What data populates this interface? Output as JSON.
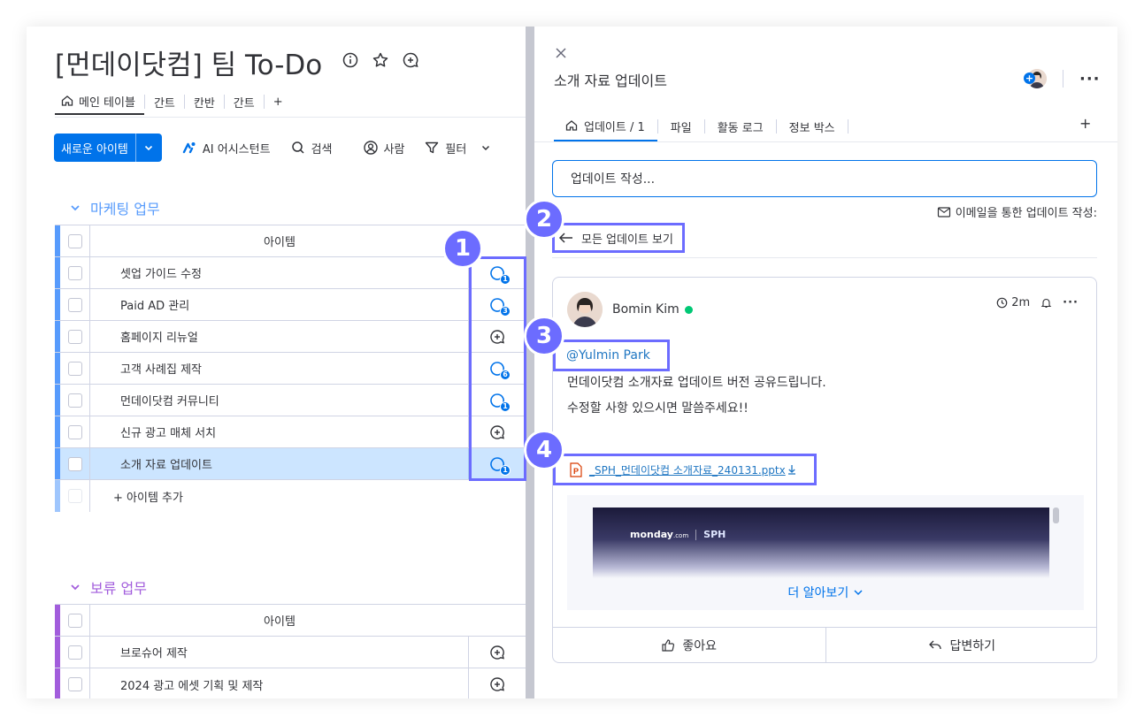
{
  "board": {
    "title": "[먼데이닷컴] 팀 To-Do",
    "views": [
      "메인 테이블",
      "간트",
      "칸반",
      "간트",
      "+"
    ],
    "toolbar": {
      "new_item": "새로운 아이템",
      "ai": "AI 어시스턴트",
      "search": "검색",
      "person": "사람",
      "filter": "필터"
    }
  },
  "groups": [
    {
      "title": "마케팅 업무",
      "color": "#579bfc",
      "header": "아이템",
      "items": [
        {
          "name": "셋업 가이드 수정",
          "badge": "1"
        },
        {
          "name": "Paid AD 관리",
          "badge": "3"
        },
        {
          "name": "홈페이지 리뉴얼",
          "badge": ""
        },
        {
          "name": "고객 사례집 제작",
          "badge": "6"
        },
        {
          "name": "먼데이닷컴 커뮤니티",
          "badge": "1"
        },
        {
          "name": "신규 광고 매체 서치",
          "badge": ""
        },
        {
          "name": "소개 자료 업데이트",
          "badge": "1"
        }
      ],
      "add_label": "+ 아이템 추가"
    },
    {
      "title": "보류 업무",
      "color": "#a25ddc",
      "header": "아이템",
      "items": [
        {
          "name": "브로슈어 제작",
          "badge": ""
        },
        {
          "name": "2024 광고 에셋 기획 및 제작",
          "badge": ""
        }
      ]
    }
  ],
  "panel": {
    "item_title": "소개 자료 업데이트",
    "tabs": [
      "업데이트 / 1",
      "파일",
      "활동 로그",
      "정보 박스"
    ],
    "tab_plus": "+",
    "composer_placeholder": "업데이트 작성...",
    "email_note": "이메일을 통한 업데이트 작성:",
    "all_updates": "모든 업데이트 보기",
    "post": {
      "author": "Bomin Kim",
      "time": "2m",
      "mention": "@Yulmin Park",
      "line1": "먼데이닷컴 소개자료 업데이트 버전 공유드립니다.",
      "line2": "수정할 사항 있으시면 말씀주세요!!",
      "attachment": "_SPH_먼데이닷컴 소개자료_240131.pptx",
      "preview_brand1": "monday",
      "preview_brand1_suffix": ".com",
      "preview_brand2": "SPH",
      "more": "더 알아보기",
      "like": "좋아요",
      "reply": "답변하기"
    }
  },
  "annotations": [
    "1",
    "2",
    "3",
    "4"
  ],
  "colors": {
    "primary": "#0073ea",
    "annotation": "#6c6cff",
    "selected_row": "#cce5ff",
    "online": "#00c875"
  }
}
